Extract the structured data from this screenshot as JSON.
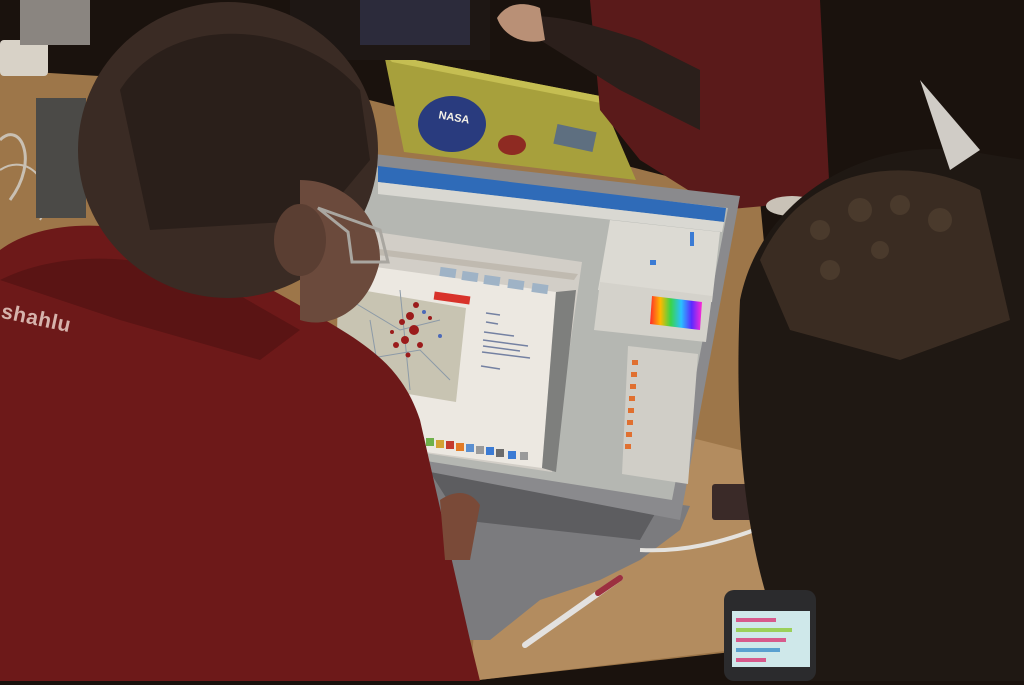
{
  "scene": {
    "shirt_lettering": "shahlu",
    "laptop_sticker": "NASA"
  },
  "colors": {
    "shirt": "#6f1a1a",
    "table": "#b48a5c",
    "laptop": "#8d8d8f",
    "screen_bg": "#b9bab5",
    "map_marker": "#9b1b1b",
    "alert_red": "#d8322a"
  }
}
